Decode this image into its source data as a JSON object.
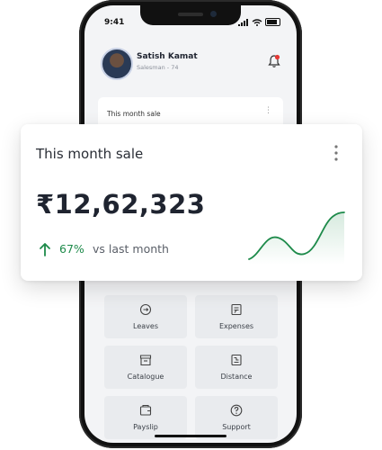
{
  "status_bar": {
    "time": "9:41"
  },
  "user": {
    "name": "Satish Kamat",
    "role": "Salesman - 74"
  },
  "small_card": {
    "title": "This month sale"
  },
  "sale_card": {
    "title": "This month sale",
    "amount": "₹12,62,323",
    "change_pct": "67%",
    "comparison": "vs last month",
    "accent_color": "#1d8a4a"
  },
  "tiles": [
    {
      "label": "Leaves",
      "icon": "leaves-icon"
    },
    {
      "label": "Expenses",
      "icon": "expenses-icon"
    },
    {
      "label": "Catalogue",
      "icon": "catalogue-icon"
    },
    {
      "label": "Distance",
      "icon": "distance-icon"
    },
    {
      "label": "Payslip",
      "icon": "payslip-icon"
    },
    {
      "label": "Support",
      "icon": "support-icon"
    }
  ]
}
